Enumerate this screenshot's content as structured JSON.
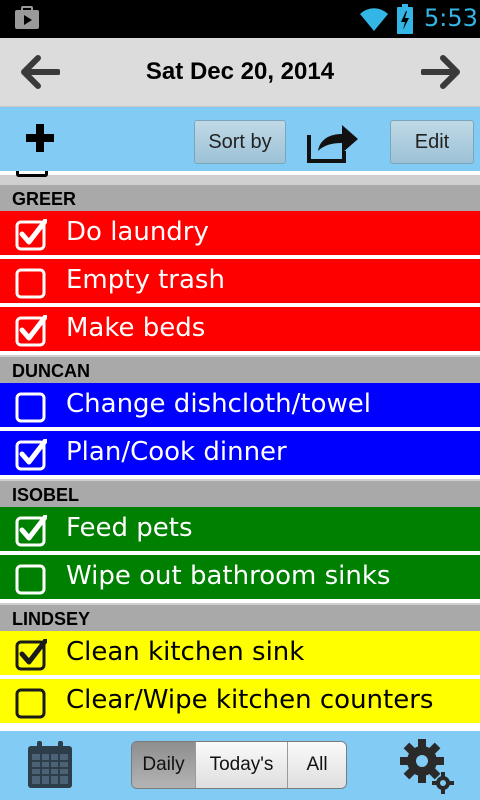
{
  "status_bar": {
    "time": "5:53",
    "time_color": "#33b5e5"
  },
  "date_bar": {
    "title": "Sat Dec 20, 2014",
    "prev_icon": "arrow-left-icon",
    "next_icon": "arrow-right-icon"
  },
  "toolbar": {
    "add_icon": "plus-icon",
    "sort_label": "Sort by",
    "share_icon": "share-icon",
    "edit_label": "Edit",
    "background": "#81cbf5"
  },
  "groups": [
    {
      "name": "GREER",
      "color": "#ff0000",
      "text_color": "#ffffff",
      "tasks": [
        {
          "label": "Do laundry",
          "checked": true
        },
        {
          "label": "Empty trash",
          "checked": false
        },
        {
          "label": "Make beds",
          "checked": true
        }
      ]
    },
    {
      "name": "DUNCAN",
      "color": "#0000ff",
      "text_color": "#ffffff",
      "tasks": [
        {
          "label": "Change dishcloth/towel",
          "checked": false
        },
        {
          "label": "Plan/Cook dinner",
          "checked": true
        }
      ]
    },
    {
      "name": "ISOBEL",
      "color": "#008000",
      "text_color": "#ffffff",
      "tasks": [
        {
          "label": "Feed pets",
          "checked": true
        },
        {
          "label": "Wipe out bathroom sinks",
          "checked": false
        }
      ]
    },
    {
      "name": "LINDSEY",
      "color": "#ffff00",
      "text_color": "#000000",
      "tasks": [
        {
          "label": "Clean kitchen sink",
          "checked": true
        },
        {
          "label": "Clear/Wipe kitchen counters",
          "checked": false
        }
      ]
    }
  ],
  "bottom_bar": {
    "calendar_icon": "calendar-icon",
    "views": [
      {
        "label": "Daily",
        "active": true
      },
      {
        "label": "Today's",
        "active": false
      },
      {
        "label": "All",
        "active": false
      }
    ],
    "settings_icon": "gear-icon"
  }
}
